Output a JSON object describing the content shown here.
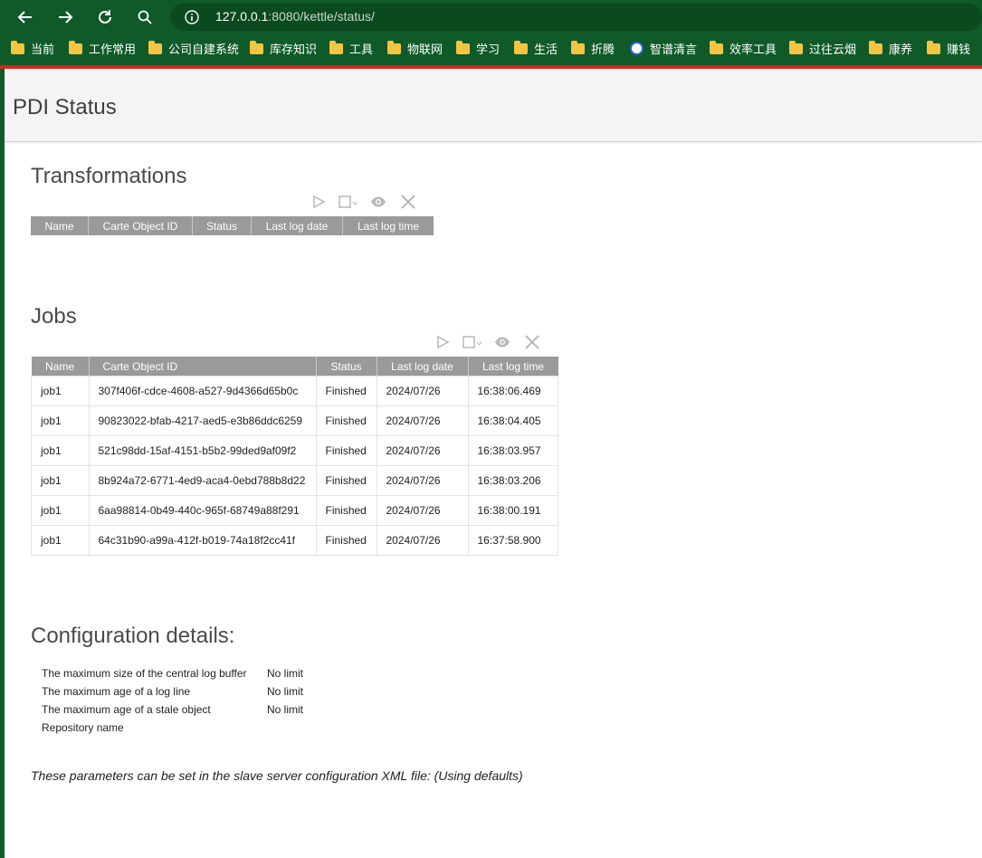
{
  "browser": {
    "url_host": "127.0.0.1",
    "url_rest": ":8080/kettle/status/",
    "bookmarks": [
      "当前",
      "工作常用",
      "公司自建系统",
      "库存知识",
      "工具",
      "物联网",
      "学习",
      "生活",
      "折腾",
      "智谱清言",
      "效率工具",
      "过往云烟",
      "康养",
      "赚钱"
    ]
  },
  "page": {
    "title": "PDI Status"
  },
  "transformations": {
    "title": "Transformations",
    "columns": [
      "Name",
      "Carte Object ID",
      "Status",
      "Last log date",
      "Last log time"
    ]
  },
  "jobs": {
    "title": "Jobs",
    "columns": [
      "Name",
      "Carte Object ID",
      "Status",
      "Last log date",
      "Last log time"
    ],
    "rows": [
      [
        "job1",
        "307f406f-cdce-4608-a527-9d4366d65b0c",
        "Finished",
        "2024/07/26",
        "16:38:06.469"
      ],
      [
        "job1",
        "90823022-bfab-4217-aed5-e3b86ddc6259",
        "Finished",
        "2024/07/26",
        "16:38:04.405"
      ],
      [
        "job1",
        "521c98dd-15af-4151-b5b2-99ded9af09f2",
        "Finished",
        "2024/07/26",
        "16:38:03.957"
      ],
      [
        "job1",
        "8b924a72-6771-4ed9-aca4-0ebd788b8d22",
        "Finished",
        "2024/07/26",
        "16:38:03.206"
      ],
      [
        "job1",
        "6aa98814-0b49-440c-965f-68749a88f291",
        "Finished",
        "2024/07/26",
        "16:38:00.191"
      ],
      [
        "job1",
        "64c31b90-a99a-412f-b019-74a18f2cc41f",
        "Finished",
        "2024/07/26",
        "16:37:58.900"
      ]
    ]
  },
  "config": {
    "title": "Configuration details:",
    "rows": [
      [
        "The maximum size of the central log buffer",
        "No limit"
      ],
      [
        "The maximum age of a log line",
        "No limit"
      ],
      [
        "The maximum age of a stale object",
        "No limit"
      ],
      [
        "Repository name",
        ""
      ]
    ],
    "note": "These parameters can be set in the slave server configuration XML file: (Using defaults)"
  },
  "colors": {
    "browser_bg": "#0f5a28",
    "accent_line": "#d8261b",
    "table_header": "#9a9a9a",
    "toolbar_icon": "#b8b8b8"
  }
}
